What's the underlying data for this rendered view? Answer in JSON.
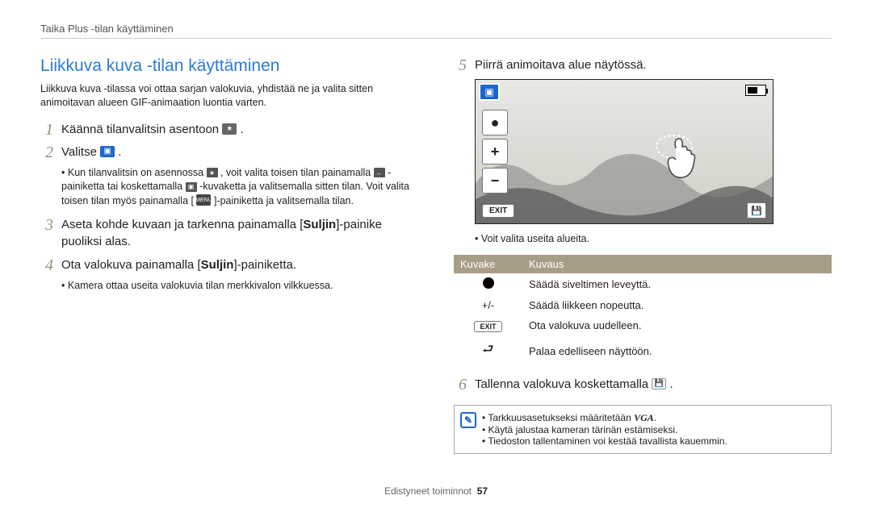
{
  "header": {
    "breadcrumb": "Taika Plus -tilan käyttäminen"
  },
  "section": {
    "title": "Liikkuva kuva -tilan käyttäminen",
    "intro": "Liikkuva kuva -tilassa voi ottaa sarjan valokuvia, yhdistää ne ja valita sitten animoitavan alueen GIF-animaation luontia varten."
  },
  "steps": {
    "s1": {
      "num": "1",
      "text_a": "Käännä tilanvalitsin asentoon ",
      "text_b": " ."
    },
    "s2": {
      "num": "2",
      "text_a": "Valitse ",
      "text_b": " .",
      "bullets": {
        "b1a": "Kun tilanvalitsin on asennossa ",
        "b1b": " , voit valita toisen tilan painamalla ",
        "b1c": " -painiketta tai koskettamalla ",
        "b1d": " -kuvaketta ja valitsemalla sitten tilan. Voit valita toisen tilan myös painamalla [",
        "b1e": "]-painiketta ja valitsemalla tilan."
      }
    },
    "s3": {
      "num": "3",
      "text_a": "Aseta kohde kuvaan ja tarkenna painamalla [",
      "text_bold": "Suljin",
      "text_b": "]-painike puoliksi alas."
    },
    "s4": {
      "num": "4",
      "text_a": "Ota valokuva painamalla [",
      "text_bold": "Suljin",
      "text_b": "]-painiketta.",
      "bullets": {
        "b1": "Kamera ottaa useita valokuvia tilan merkkivalon vilkkuessa."
      }
    },
    "s5": {
      "num": "5",
      "text": "Piirrä animoitava alue näytössä.",
      "bullets": {
        "b1": "Voit valita useita alueita."
      }
    },
    "s6": {
      "num": "6",
      "text_a": "Tallenna valokuva koskettamalla ",
      "text_b": " ."
    }
  },
  "screen": {
    "exit": "EXIT"
  },
  "table": {
    "head": {
      "c1": "Kuvake",
      "c2": "Kuvaus"
    },
    "rows": {
      "r1": {
        "icon": "dot",
        "desc": "Säädä siveltimen leveyttä."
      },
      "r2": {
        "icon": "+/-",
        "desc": "Säädä liikkeen nopeutta."
      },
      "r3": {
        "icon": "EXIT",
        "desc": "Ota valokuva uudelleen."
      },
      "r4": {
        "icon": "back",
        "desc": "Palaa edelliseen näyttöön."
      }
    }
  },
  "note": {
    "items": {
      "n1a": "Tarkkuusasetukseksi määritetään ",
      "n1b": ".",
      "n2": "Käytä jalustaa kameran tärinän estämiseksi.",
      "n3": "Tiedoston tallentaminen voi kestää tavallista kauemmin."
    },
    "vga": "VGA"
  },
  "footer": {
    "label": "Edistyneet toiminnot",
    "page": "57"
  }
}
